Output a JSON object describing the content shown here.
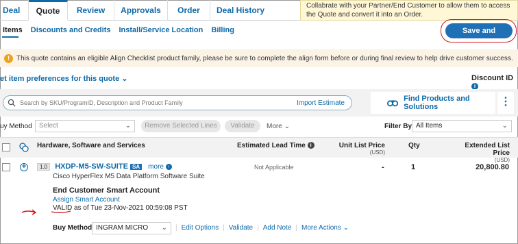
{
  "tabs": [
    "Deal",
    "Quote",
    "Review",
    "Approvals",
    "Order",
    "Deal History"
  ],
  "tooltip": {
    "text": "Collabrate with your Partner/End Customer to allow them to access the Quote and convert it into an Order."
  },
  "subtabs": [
    "Items",
    "Discounts and Credits",
    "Install/Service Location",
    "Billing"
  ],
  "save_button": "Save and Continue",
  "banner": {
    "text": "This quote contains an eligible Align Checklist product family, please be sure to complete the align form before or during final review to help drive customer success."
  },
  "prefs_link": "et item preferences for this quote",
  "discount_id": "Discount ID",
  "search": {
    "placeholder": "Search by SKU/ProgramID, Description and  Product Family",
    "import": "Import Estimate"
  },
  "find_products": "Find Products and Solutions",
  "actions": {
    "buy_method_label": "uy Method",
    "buy_method_value": "Select",
    "remove_btn": "Remove Selected Lines",
    "validate_btn": "Validate",
    "more": "More",
    "filter_label": "Filter By",
    "filter_value": "All Items"
  },
  "table": {
    "col_hw": "Hardware, Software and Services",
    "col_lead": "Estimated Lead Time",
    "col_unit": "Unit List Price",
    "col_unit_sub": "(USD)",
    "col_qty": "Qty",
    "col_ext": "Extended List Price",
    "col_ext_sub": "(USD)"
  },
  "row": {
    "line": "1.0",
    "sku": "HXDP-M5-SW-SUITE",
    "sa_badge": "SA",
    "more": "more",
    "description": "Cisco HyperFlex M5 Data Platform Software Suite",
    "lead_time": "Not Applicable",
    "unit_price": "-",
    "qty": "1",
    "ext_price": "20,800.80",
    "smart_account_title": "End Customer Smart Account",
    "assign_link": "Assign Smart Account",
    "valid_prefix": "VALID",
    "valid_text": "as of Tue 23-Nov-2021 00:59:08 PST",
    "buy_method_label": "Buy Method",
    "buy_method_value": "INGRAM MICRO",
    "links": [
      "Edit Options",
      "Validate",
      "Add Note",
      "More Actions"
    ]
  },
  "colors": {
    "accent": "#0d6aa8",
    "annotation": "#d4141c",
    "button": "#1f70b5"
  }
}
